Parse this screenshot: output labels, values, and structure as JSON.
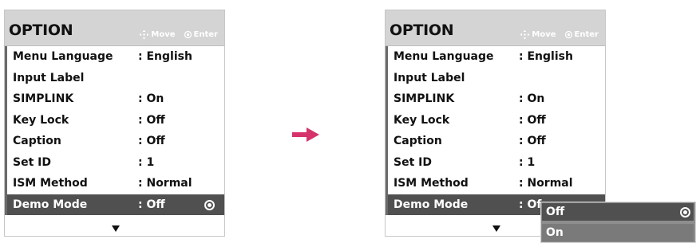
{
  "panels": [
    {
      "title": "OPTION",
      "nav_hint_move": "Move",
      "nav_hint_enter": "Enter",
      "items": [
        {
          "label": "Menu Language",
          "value": ": English"
        },
        {
          "label": "Input Label",
          "value": ""
        },
        {
          "label": "SIMPLINK",
          "value": ": On"
        },
        {
          "label": "Key Lock",
          "value": ": Off"
        },
        {
          "label": "Caption",
          "value": ": Off"
        },
        {
          "label": "Set ID",
          "value": ": 1"
        },
        {
          "label": "ISM Method",
          "value": ": Normal"
        },
        {
          "label": "Demo Mode",
          "value": ": Off"
        }
      ]
    },
    {
      "title": "OPTION",
      "nav_hint_move": "Move",
      "nav_hint_enter": "Enter",
      "items": [
        {
          "label": "Menu Language",
          "value": ": English"
        },
        {
          "label": "Input Label",
          "value": ""
        },
        {
          "label": "SIMPLINK",
          "value": ": On"
        },
        {
          "label": "Key Lock",
          "value": ": Off"
        },
        {
          "label": "Caption",
          "value": ": Off"
        },
        {
          "label": "Set ID",
          "value": ": 1"
        },
        {
          "label": "ISM Method",
          "value": ": Normal"
        },
        {
          "label": "Demo Mode",
          "value": ": Of"
        }
      ],
      "dropdown": {
        "options": [
          "Off",
          "On"
        ],
        "selected": "Off"
      }
    }
  ],
  "selected_item": "Demo Mode",
  "icons": {
    "move": "four-way-arrow-icon",
    "enter": "enter-icon",
    "transition": "right-arrow-icon",
    "scroll": "scroll-down-icon"
  },
  "colors": {
    "header_bg": "#d4d4d4",
    "selected_row_bg": "#505050",
    "popup_bg": "#8e8e8e",
    "arrow": "#d6336c"
  }
}
